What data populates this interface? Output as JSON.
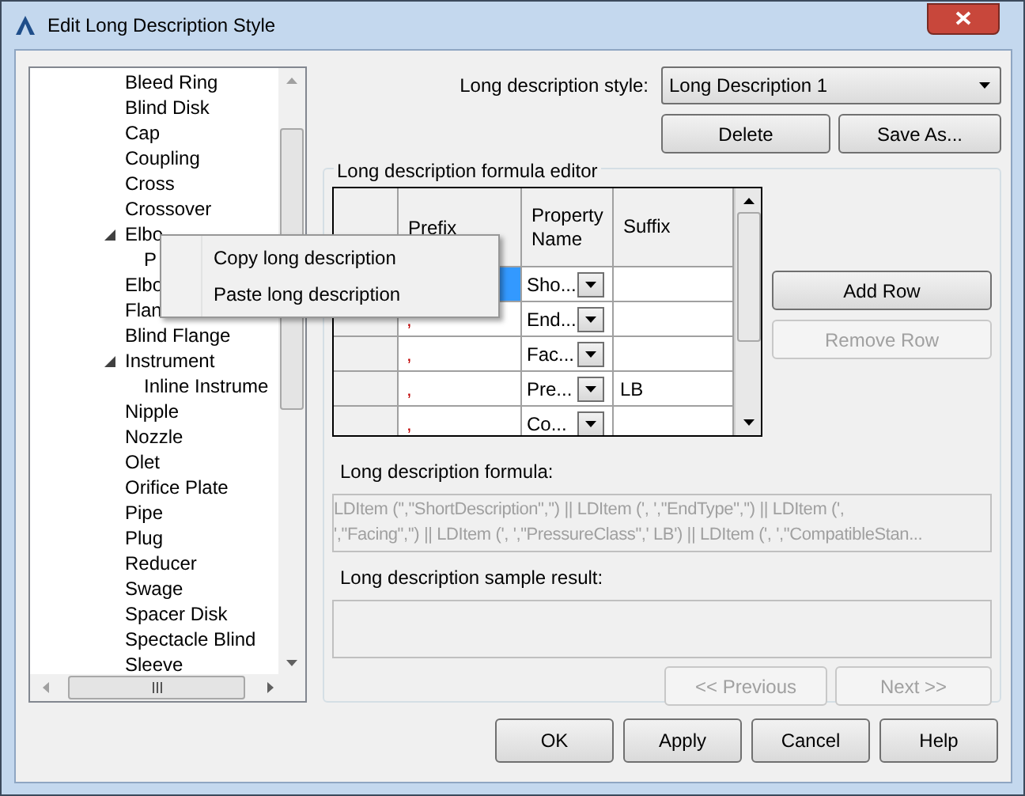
{
  "window": {
    "title": "Edit Long Description Style"
  },
  "tree": [
    {
      "label": "Bleed Ring"
    },
    {
      "label": "Blind Disk"
    },
    {
      "label": "Cap"
    },
    {
      "label": "Coupling"
    },
    {
      "label": "Cross"
    },
    {
      "label": "Crossover"
    },
    {
      "label": "Elbo",
      "expanded": true,
      "children": [
        {
          "label": "P"
        }
      ]
    },
    {
      "label": "Elbo"
    },
    {
      "label": "Flan"
    },
    {
      "label": "Blind Flange"
    },
    {
      "label": "Instrument",
      "expanded": true,
      "children": [
        {
          "label": "Inline Instrume"
        }
      ]
    },
    {
      "label": "Nipple"
    },
    {
      "label": "Nozzle"
    },
    {
      "label": "Olet"
    },
    {
      "label": "Orifice Plate"
    },
    {
      "label": "Pipe"
    },
    {
      "label": "Plug"
    },
    {
      "label": "Reducer"
    },
    {
      "label": "Swage"
    },
    {
      "label": "Spacer Disk"
    },
    {
      "label": "Spectacle Blind"
    },
    {
      "label": "Sleeve"
    }
  ],
  "style_label": "Long description style:",
  "style_value": "Long Description 1",
  "style_buttons": [
    {
      "label": "Delete",
      "disabled": false
    },
    {
      "label": "Save As...",
      "disabled": false
    }
  ],
  "editor": {
    "title": "Long description formula editor",
    "columns": [
      "Prefix",
      "Property Name",
      "Suffix"
    ],
    "rows": [
      {
        "prefix": "",
        "property": "Sho...",
        "suffix": "",
        "selected": true
      },
      {
        "prefix": ",",
        "property": "End...",
        "suffix": "",
        "selected": false
      },
      {
        "prefix": ",",
        "property": "Fac...",
        "suffix": "",
        "selected": false
      },
      {
        "prefix": ",",
        "property": "Pre...",
        "suffix": "LB",
        "selected": false
      },
      {
        "prefix": ",",
        "property": "Co...",
        "suffix": "",
        "selected": false
      }
    ],
    "row_buttons": [
      {
        "label": "Add Row",
        "disabled": false
      },
      {
        "label": "Remove Row",
        "disabled": true
      }
    ],
    "formula_label": "Long description formula:",
    "formula_lines": [
      "LDItem ('',\"ShortDescription\",'') || LDItem (', ',\"EndType\",'') || LDItem (',",
      "',\"Facing\",'') || LDItem (', ',\"PressureClass\",' LB') || LDItem (', ',\"CompatibleStan..."
    ],
    "sample_label": "Long description sample result:",
    "nav_buttons": [
      {
        "label": "<< Previous",
        "disabled": true
      },
      {
        "label": "Next >>",
        "disabled": true
      }
    ]
  },
  "context_menu": [
    "Copy long description",
    "Paste long description"
  ],
  "buttons": [
    {
      "label": "OK",
      "disabled": false
    },
    {
      "label": "Apply",
      "disabled": false
    },
    {
      "label": "Cancel",
      "disabled": false
    },
    {
      "label": "Help",
      "disabled": false
    }
  ]
}
